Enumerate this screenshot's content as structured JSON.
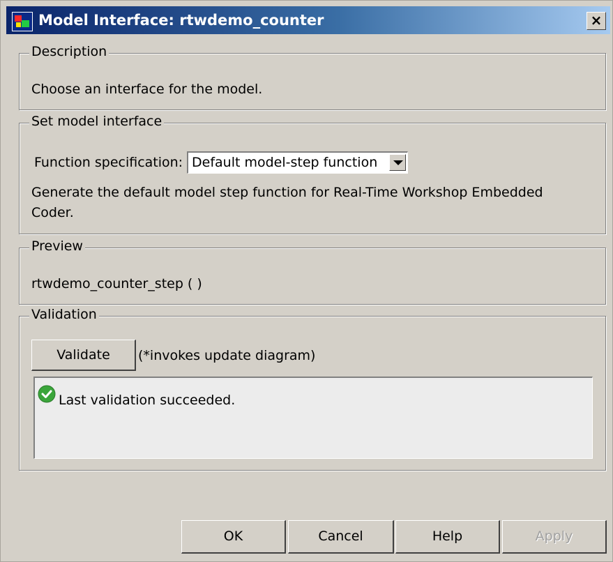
{
  "window": {
    "title": "Model Interface: rtwdemo_counter",
    "close_label": "×"
  },
  "description": {
    "legend": "Description",
    "text": "Choose an interface for the model."
  },
  "set_interface": {
    "legend": "Set model interface",
    "function_spec_label": "Function specification:",
    "function_spec_value": "Default model-step function",
    "help_line1": "Generate the default model step function for Real-Time Workshop Embedded",
    "help_line2": "Coder."
  },
  "preview": {
    "legend": "Preview",
    "text": "rtwdemo_counter_step ( )"
  },
  "validation": {
    "legend": "Validation",
    "validate_label": "Validate",
    "note": "(*invokes update diagram)",
    "status_text": "Last validation succeeded.",
    "status_icon": "success-check-icon",
    "status_color": "#3aa53a"
  },
  "buttons": {
    "ok": "OK",
    "cancel": "Cancel",
    "help": "Help",
    "apply": "Apply"
  },
  "colors": {
    "title_gradient_start": "#0a246a",
    "title_gradient_end": "#a6caf0",
    "dialog_bg": "#d4d0c8"
  }
}
